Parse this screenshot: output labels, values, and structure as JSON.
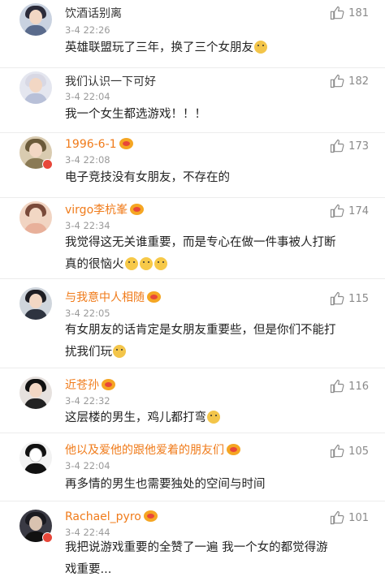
{
  "comments": [
    {
      "name": "饮酒话别离",
      "time": "3-4 22:26",
      "text": "英雄联盟玩了三年，换了三个女朋友",
      "emoji": "wink-emoji",
      "likes": "181",
      "vip": false
    },
    {
      "name": "我们认识一下可好",
      "time": "3-4 22:04",
      "text": "我一个女生都选游戏！！！",
      "likes": "182",
      "vip": false
    },
    {
      "name": "1996-6-1",
      "time": "3-4 22:08",
      "text": "电子竞技没有女朋友，不存在的",
      "likes": "173",
      "vip": true
    },
    {
      "name": "virgo李杭峯",
      "time": "3-4 22:34",
      "text_line1": "我觉得这无关谁重要，而是专心在做一件事被人打断",
      "text_line2": "真的很恼火",
      "likes": "174",
      "vip": true
    },
    {
      "name": "与我意中人相随",
      "time": "3-4 22:05",
      "text_line1": "有女朋友的话肯定是女朋友重要些，但是你们不能打",
      "text_line2": "扰我们玩",
      "likes": "115",
      "vip": true
    },
    {
      "name": "近苍孙",
      "time": "3-4 22:32",
      "text": "这层楼的男生，鸡儿都打弯",
      "likes": "116",
      "vip": true
    },
    {
      "name": "他以及爱他的跟他爱着的朋友们",
      "time": "3-4 22:04",
      "text": "再多情的男生也需要独处的空间与时间",
      "likes": "105",
      "vip": true
    },
    {
      "name": "Rachael_pyro",
      "time": "3-4 22:44",
      "text_line1": "我把说游戏重要的全赞了一遍 我一个女的都觉得游",
      "text_line2": "戏重要...",
      "likes": "101",
      "vip": true
    }
  ],
  "colors": {
    "vip_name": "#f07b1a",
    "plain_name": "#333333",
    "meta": "#9a9a9a",
    "badge": "#e8473a"
  },
  "icons": {
    "like": "thumbs-up-icon",
    "vip": "crown-icon"
  }
}
